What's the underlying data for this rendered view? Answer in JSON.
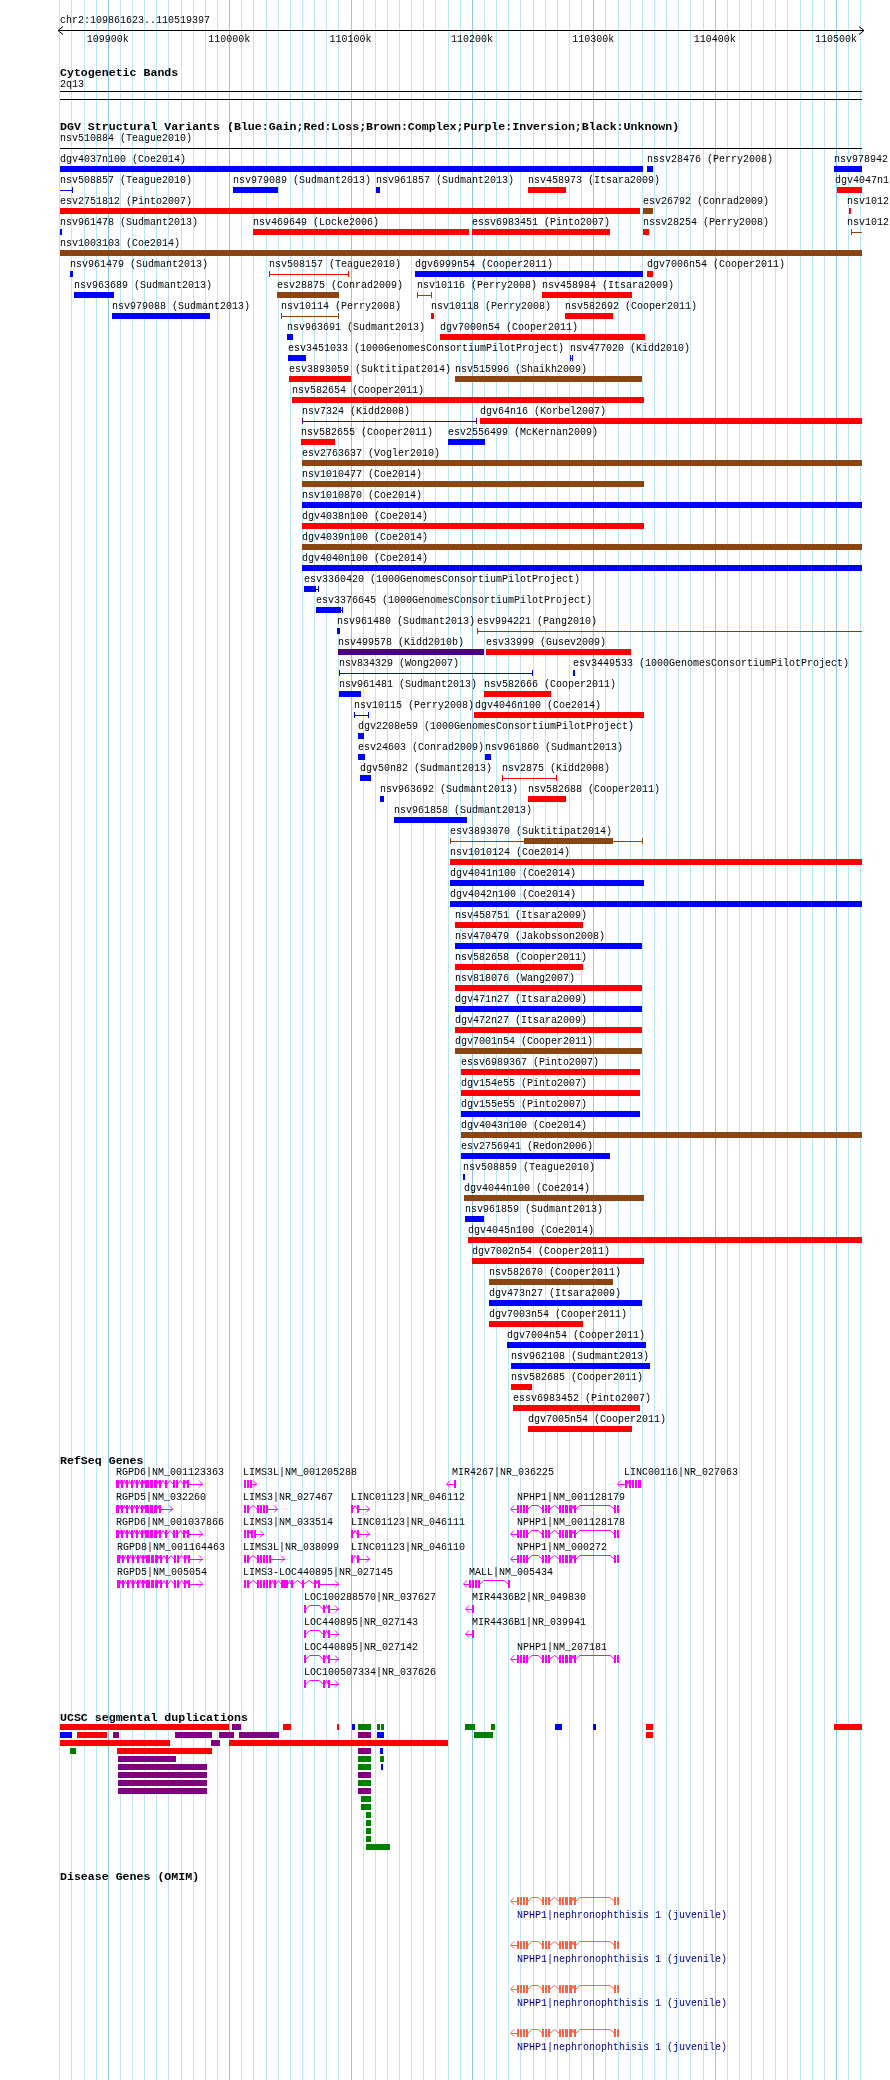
{
  "ruler": {
    "region": "chr2:109861623..110519397",
    "ticks": [
      "109900k",
      "110000k",
      "110100k",
      "110200k",
      "110300k",
      "110400k",
      "110500k"
    ]
  },
  "cytogenetic_bands": {
    "title": "Cytogenetic Bands",
    "band": "2q13"
  },
  "dgv": {
    "title": "DGV Structural Variants (Blue:Gain;Red:Loss;Brown:Complex;Purple:Inversion;Black:Unknown)",
    "rows": [
      {
        "items": [
          {
            "label": "nsv510884 (Teague2010)",
            "color": "#000000",
            "kind": "span"
          }
        ]
      },
      {
        "items": [
          {
            "label": "dgv4037n100 (Coe2014)",
            "color": "#0000ff",
            "kind": "bar"
          },
          {
            "label": "nssv28476 (Perry2008)",
            "color": "#0000ff",
            "kind": "bar"
          },
          {
            "label": "nsv978942",
            "color": "#0000ff",
            "kind": "bar"
          }
        ]
      },
      {
        "items": [
          {
            "label": "nsv508857 (Teague2010)",
            "color": "#0000ff",
            "kind": "span"
          },
          {
            "label": "nsv979089 (Sudmant2013)",
            "color": "#0000ff",
            "kind": "bar"
          },
          {
            "label": "nsv961857 (Sudmant2013)",
            "color": "#0000ff",
            "kind": "bar"
          },
          {
            "label": "nsv458973 (Itsara2009)",
            "color": "#ff0000",
            "kind": "bar"
          },
          {
            "label": "dgv4047n1",
            "color": "#ff0000",
            "kind": "bar"
          }
        ]
      },
      {
        "items": [
          {
            "label": "esv2751812 (Pinto2007)",
            "color": "#ff0000",
            "kind": "bar"
          },
          {
            "label": "esv26792 (Conrad2009)",
            "color": "#8b4513",
            "kind": "bar"
          },
          {
            "label": "nsv1012",
            "color": "#ff0000",
            "kind": "bar"
          }
        ]
      },
      {
        "items": [
          {
            "label": "nsv961478 (Sudmant2013)",
            "color": "#0000ff",
            "kind": "bar"
          },
          {
            "label": "nsv469649 (Locke2006)",
            "color": "#ff0000",
            "kind": "bar"
          },
          {
            "label": "essv6983451 (Pinto2007)",
            "color": "#ff0000",
            "kind": "bar"
          },
          {
            "label": "nssv28254 (Perry2008)",
            "color": "#ff0000",
            "kind": "span_bar"
          },
          {
            "label": "nsv1012",
            "color": "#8b4513",
            "kind": "span"
          }
        ]
      },
      {
        "items": [
          {
            "label": "nsv1003103 (Coe2014)",
            "color": "#8b4513",
            "kind": "bar"
          }
        ]
      },
      {
        "items": [
          {
            "label": "nsv961479 (Sudmant2013)",
            "color": "#0000ff",
            "kind": "bar"
          },
          {
            "label": "nsv508157 (Teague2010)",
            "color": "#ff0000",
            "kind": "span"
          },
          {
            "label": "dgv6999n54 (Cooper2011)",
            "color": "#0000ff",
            "kind": "bar"
          },
          {
            "label": "dgv7006n54 (Cooper2011)",
            "color": "#ff0000",
            "kind": "bar"
          }
        ]
      },
      {
        "items": [
          {
            "label": "nsv963689 (Sudmant2013)",
            "color": "#0000ff",
            "kind": "bar"
          },
          {
            "label": "esv28875 (Conrad2009)",
            "color": "#8b4513",
            "kind": "bar"
          },
          {
            "label": "nsv10116 (Perry2008)",
            "color": "#8b4513",
            "kind": "span"
          },
          {
            "label": "nsv458984 (Itsara2009)",
            "color": "#ff0000",
            "kind": "bar"
          }
        ]
      },
      {
        "items": [
          {
            "label": "nsv979088 (Sudmant2013)",
            "color": "#0000ff",
            "kind": "bar"
          },
          {
            "label": "nsv10114 (Perry2008)",
            "color": "#8b4513",
            "kind": "span"
          },
          {
            "label": "nsv10118 (Perry2008)",
            "color": "#ff0000",
            "kind": "bar"
          },
          {
            "label": "nsv582692 (Cooper2011)",
            "color": "#ff0000",
            "kind": "bar"
          }
        ]
      },
      {
        "items": [
          {
            "label": "nsv963691 (Sudmant2013)",
            "color": "#0000ff",
            "kind": "bar"
          },
          {
            "label": "dgv7000n54 (Cooper2011)",
            "color": "#ff0000",
            "kind": "bar"
          }
        ]
      },
      {
        "items": [
          {
            "label": "esv3451033 (1000GenomesConsortiumPilotProject)",
            "color": "#0000ff",
            "kind": "bar"
          },
          {
            "label": "nsv477020 (Kidd2010)",
            "color": "#0000ff",
            "kind": "span"
          }
        ]
      },
      {
        "items": [
          {
            "label": "esv3893059 (Suktitipat2014)",
            "color": "#ff0000",
            "kind": "bar"
          },
          {
            "label": "nsv515996 (Shaikh2009)",
            "color": "#8b4513",
            "kind": "bar"
          }
        ]
      },
      {
        "items": [
          {
            "label": "nsv582654 (Cooper2011)",
            "color": "#ff0000",
            "kind": "bar"
          }
        ]
      },
      {
        "items": [
          {
            "label": "nsv7324 (Kidd2008)",
            "color": "#4b0082",
            "kind": "span"
          },
          {
            "label": "dgv64n16 (Korbel2007)",
            "color": "#ff0000",
            "kind": "bar"
          }
        ]
      },
      {
        "items": [
          {
            "label": "nsv582655 (Cooper2011)",
            "color": "#ff0000",
            "kind": "bar"
          },
          {
            "label": "esv2556499 (McKernan2009)",
            "color": "#0000ff",
            "kind": "bar"
          }
        ]
      },
      {
        "items": [
          {
            "label": "esv2763637 (Vogler2010)",
            "color": "#8b4513",
            "kind": "bar"
          }
        ]
      },
      {
        "items": [
          {
            "label": "nsv1010477 (Coe2014)",
            "color": "#8b4513",
            "kind": "bar"
          }
        ]
      },
      {
        "items": [
          {
            "label": "nsv1010870 (Coe2014)",
            "color": "#0000ff",
            "kind": "bar"
          }
        ]
      },
      {
        "items": [
          {
            "label": "dgv4038n100 (Coe2014)",
            "color": "#ff0000",
            "kind": "bar"
          }
        ]
      },
      {
        "items": [
          {
            "label": "dgv4039n100 (Coe2014)",
            "color": "#8b4513",
            "kind": "bar"
          }
        ]
      },
      {
        "items": [
          {
            "label": "dgv4040n100 (Coe2014)",
            "color": "#0000ff",
            "kind": "bar"
          }
        ]
      },
      {
        "items": [
          {
            "label": "esv3360420 (1000GenomesConsortiumPilotProject)",
            "color": "#0000ff",
            "kind": "span_bar"
          }
        ]
      },
      {
        "items": [
          {
            "label": "esv3376645 (1000GenomesConsortiumPilotProject)",
            "color": "#0000ff",
            "kind": "span_bar"
          }
        ]
      },
      {
        "items": [
          {
            "label": "nsv961480 (Sudmant2013)",
            "color": "#0000ff",
            "kind": "bar"
          },
          {
            "label": "esv994221 (Pang2010)",
            "color": "#ff0000",
            "kind": "span"
          }
        ]
      },
      {
        "items": [
          {
            "label": "nsv499578 (Kidd2010b)",
            "color": "#4b0082",
            "kind": "bar"
          },
          {
            "label": "esv33999 (Gusev2009)",
            "color": "#ff0000",
            "kind": "bar"
          }
        ]
      },
      {
        "items": [
          {
            "label": "nsv834329 (Wong2007)",
            "color": "#0000ff",
            "kind": "span"
          },
          {
            "label": "esv3449533 (1000GenomesConsortiumPilotProject)",
            "color": "#0000ff",
            "kind": "span"
          }
        ]
      },
      {
        "items": [
          {
            "label": "nsv961481 (Sudmant2013)",
            "color": "#0000ff",
            "kind": "bar"
          },
          {
            "label": "nsv582666 (Cooper2011)",
            "color": "#ff0000",
            "kind": "bar"
          }
        ]
      },
      {
        "items": [
          {
            "label": "nsv10115 (Perry2008)",
            "color": "#0000ff",
            "kind": "span"
          },
          {
            "label": "dgv4046n100 (Coe2014)",
            "color": "#ff0000",
            "kind": "bar"
          }
        ]
      },
      {
        "items": [
          {
            "label": "dgv2208e59 (1000GenomesConsortiumPilotProject)",
            "color": "#0000ff",
            "kind": "bar"
          }
        ]
      },
      {
        "items": [
          {
            "label": "esv24603 (Conrad2009)",
            "color": "#0000ff",
            "kind": "bar"
          },
          {
            "label": "nsv961860 (Sudmant2013)",
            "color": "#0000ff",
            "kind": "bar"
          }
        ]
      },
      {
        "items": [
          {
            "label": "dgv50n82 (Sudmant2013)",
            "color": "#0000ff",
            "kind": "bar"
          },
          {
            "label": "nsv2875 (Kidd2008)",
            "color": "#ff0000",
            "kind": "span"
          }
        ]
      },
      {
        "items": [
          {
            "label": "nsv963692 (Sudmant2013)",
            "color": "#0000ff",
            "kind": "bar"
          },
          {
            "label": "nsv582688 (Cooper2011)",
            "color": "#ff0000",
            "kind": "bar"
          }
        ]
      },
      {
        "items": [
          {
            "label": "nsv961858 (Sudmant2013)",
            "color": "#0000ff",
            "kind": "bar"
          }
        ]
      },
      {
        "items": [
          {
            "label": "esv3893070 (Suktitipat2014)",
            "color": "#8b4513",
            "kind": "span_bar"
          }
        ]
      },
      {
        "items": [
          {
            "label": "nsv1010124 (Coe2014)",
            "color": "#ff0000",
            "kind": "bar"
          }
        ]
      },
      {
        "items": [
          {
            "label": "dgv4041n100 (Coe2014)",
            "color": "#0000ff",
            "kind": "bar"
          }
        ]
      },
      {
        "items": [
          {
            "label": "dgv4042n100 (Coe2014)",
            "color": "#0000ff",
            "kind": "bar"
          }
        ]
      },
      {
        "items": [
          {
            "label": "nsv458751 (Itsara2009)",
            "color": "#ff0000",
            "kind": "bar"
          }
        ]
      },
      {
        "items": [
          {
            "label": "nsv470479 (Jakobsson2008)",
            "color": "#0000ff",
            "kind": "bar"
          }
        ]
      },
      {
        "items": [
          {
            "label": "nsv582658 (Cooper2011)",
            "color": "#ff0000",
            "kind": "bar"
          }
        ]
      },
      {
        "items": [
          {
            "label": "nsv818076 (Wang2007)",
            "color": "#ff0000",
            "kind": "bar"
          }
        ]
      },
      {
        "items": [
          {
            "label": "dgv471n27 (Itsara2009)",
            "color": "#0000ff",
            "kind": "bar"
          }
        ]
      },
      {
        "items": [
          {
            "label": "dgv472n27 (Itsara2009)",
            "color": "#ff0000",
            "kind": "bar"
          }
        ]
      },
      {
        "items": [
          {
            "label": "dgv7001n54 (Cooper2011)",
            "color": "#8b4513",
            "kind": "bar"
          }
        ]
      },
      {
        "items": [
          {
            "label": "essv6989367 (Pinto2007)",
            "color": "#ff0000",
            "kind": "bar"
          }
        ]
      },
      {
        "items": [
          {
            "label": "dgv154e55 (Pinto2007)",
            "color": "#ff0000",
            "kind": "bar"
          }
        ]
      },
      {
        "items": [
          {
            "label": "dgv155e55 (Pinto2007)",
            "color": "#0000ff",
            "kind": "bar"
          }
        ]
      },
      {
        "items": [
          {
            "label": "dgv4043n100 (Coe2014)",
            "color": "#8b4513",
            "kind": "bar"
          }
        ]
      },
      {
        "items": [
          {
            "label": "esv2756941 (Redon2006)",
            "color": "#0000ff",
            "kind": "bar"
          }
        ]
      },
      {
        "items": [
          {
            "label": "nsv508859 (Teague2010)",
            "color": "#0000ff",
            "kind": "bar"
          }
        ]
      },
      {
        "items": [
          {
            "label": "dgv4044n100 (Coe2014)",
            "color": "#8b4513",
            "kind": "bar"
          }
        ]
      },
      {
        "items": [
          {
            "label": "nsv961859 (Sudmant2013)",
            "color": "#0000ff",
            "kind": "bar"
          }
        ]
      },
      {
        "items": [
          {
            "label": "dgv4045n100 (Coe2014)",
            "color": "#ff0000",
            "kind": "bar"
          }
        ]
      },
      {
        "items": [
          {
            "label": "dgv7002n54 (Cooper2011)",
            "color": "#ff0000",
            "kind": "bar"
          }
        ]
      },
      {
        "items": [
          {
            "label": "nsv582670 (Cooper2011)",
            "color": "#8b4513",
            "kind": "bar"
          }
        ]
      },
      {
        "items": [
          {
            "label": "dgv473n27 (Itsara2009)",
            "color": "#0000ff",
            "kind": "bar"
          }
        ]
      },
      {
        "items": [
          {
            "label": "dgv7003n54 (Cooper2011)",
            "color": "#ff0000",
            "kind": "bar"
          }
        ]
      },
      {
        "items": [
          {
            "label": "dgv7004n54 (Cooper2011)",
            "color": "#0000ff",
            "kind": "bar"
          }
        ]
      },
      {
        "items": [
          {
            "label": "nsv962108 (Sudmant2013)",
            "color": "#0000ff",
            "kind": "bar"
          }
        ]
      },
      {
        "items": [
          {
            "label": "nsv582685 (Cooper2011)",
            "color": "#ff0000",
            "kind": "bar"
          }
        ]
      },
      {
        "items": [
          {
            "label": "essv6983452 (Pinto2007)",
            "color": "#ff0000",
            "kind": "bar"
          }
        ]
      },
      {
        "items": [
          {
            "label": "dgv7005n54 (Cooper2011)",
            "color": "#ff0000",
            "kind": "bar"
          }
        ]
      }
    ]
  },
  "refseq": {
    "title": "RefSeq Genes",
    "rows": [
      {
        "items": [
          {
            "label": "RGPD6|NM_001123363",
            "reverse_strand": false
          },
          {
            "label": "LIMS3L|NM_001205288",
            "reverse_strand": false
          },
          {
            "label": "MIR4267|NR_036225",
            "reverse_strand": true
          },
          {
            "label": "LINC00116|NR_027063",
            "reverse_strand": true
          }
        ]
      },
      {
        "items": [
          {
            "label": "RGPD5|NM_032260",
            "reverse_strand": false
          },
          {
            "label": "LIMS3|NR_027467",
            "reverse_strand": false
          },
          {
            "label": "LINC01123|NR_046112",
            "reverse_strand": false
          },
          {
            "label": "NPHP1|NM_001128179",
            "reverse_strand": true
          }
        ]
      },
      {
        "items": [
          {
            "label": "RGPD6|NM_001037866",
            "reverse_strand": false
          },
          {
            "label": "LIMS3|NM_033514",
            "reverse_strand": false
          },
          {
            "label": "LINC01123|NR_046111",
            "reverse_strand": false
          },
          {
            "label": "NPHP1|NM_001128178",
            "reverse_strand": true
          }
        ]
      },
      {
        "items": [
          {
            "label": "RGPD8|NM_001164463",
            "reverse_strand": false
          },
          {
            "label": "LIMS3L|NR_038099",
            "reverse_strand": false
          },
          {
            "label": "LINC01123|NR_046110",
            "reverse_strand": false
          },
          {
            "label": "NPHP1|NM_000272",
            "reverse_strand": true
          }
        ]
      },
      {
        "items": [
          {
            "label": "RGPD5|NM_005054",
            "reverse_strand": false
          },
          {
            "label": "LIMS3-LOC440895|NR_027145",
            "reverse_strand": false
          },
          {
            "label": "MALL|NM_005434",
            "reverse_strand": true
          }
        ]
      },
      {
        "items": [
          {
            "label": "LOC100288570|NR_037627",
            "reverse_strand": false
          },
          {
            "label": "MIR4436B2|NR_049830",
            "reverse_strand": true
          }
        ]
      },
      {
        "items": [
          {
            "label": "LOC440895|NR_027143",
            "reverse_strand": false
          },
          {
            "label": "MIR4436B1|NR_039941",
            "reverse_strand": true
          }
        ]
      },
      {
        "items": [
          {
            "label": "LOC440895|NR_027142",
            "reverse_strand": false
          },
          {
            "label": "NPHP1|NM_207181",
            "reverse_strand": true
          }
        ]
      },
      {
        "items": [
          {
            "label": "LOC100507334|NR_037626",
            "reverse_strand": false
          }
        ]
      }
    ]
  },
  "segmental_duplications": {
    "title": "UCSC segmental duplications",
    "rows": [
      {
        "items": [
          {
            "color": "#ff0000"
          },
          {
            "color": "#800080"
          },
          {
            "color": "#ff0000"
          },
          {
            "color": "#ff0000"
          },
          {
            "color": "#0000ff"
          },
          {
            "color": "#008000"
          },
          {
            "color": "#008000"
          },
          {
            "color": "#008000"
          },
          {
            "color": "#008000"
          },
          {
            "color": "#008000"
          },
          {
            "color": "#0000ff"
          },
          {
            "color": "#0000ff"
          },
          {
            "color": "#ff0000"
          },
          {
            "color": "#ff0000"
          }
        ]
      },
      {
        "items": [
          {
            "color": "#0000ff"
          },
          {
            "color": "#ff0000"
          },
          {
            "color": "#800080"
          },
          {
            "color": "#800080"
          },
          {
            "color": "#800080"
          },
          {
            "color": "#800080"
          },
          {
            "color": "#800080"
          },
          {
            "color": "#0000ff"
          },
          {
            "color": "#008000"
          },
          {
            "color": "#ff0000"
          }
        ]
      },
      {
        "items": [
          {
            "color": "#ff0000"
          },
          {
            "color": "#800080"
          },
          {
            "color": "#ff0000"
          }
        ]
      },
      {
        "items": [
          {
            "color": "#008000"
          },
          {
            "color": "#ff0000"
          },
          {
            "color": "#800080"
          },
          {
            "color": "#0000ff"
          }
        ]
      },
      {
        "items": [
          {
            "color": "#800080"
          },
          {
            "color": "#008000"
          },
          {
            "color": "#008000"
          }
        ]
      },
      {
        "items": [
          {
            "color": "#800080"
          },
          {
            "color": "#008000"
          },
          {
            "color": "#0000ff"
          }
        ]
      },
      {
        "items": [
          {
            "color": "#800080"
          },
          {
            "color": "#800080"
          }
        ]
      },
      {
        "items": [
          {
            "color": "#800080"
          },
          {
            "color": "#008000"
          }
        ]
      },
      {
        "items": [
          {
            "color": "#800080"
          },
          {
            "color": "#800080"
          }
        ]
      },
      {
        "items": [
          {
            "color": "#008000"
          }
        ]
      },
      {
        "items": [
          {
            "color": "#008000"
          }
        ]
      },
      {
        "items": [
          {
            "color": "#008000"
          }
        ]
      },
      {
        "items": [
          {
            "color": "#008000"
          }
        ]
      },
      {
        "items": [
          {
            "color": "#008000"
          }
        ]
      },
      {
        "items": [
          {
            "color": "#008000"
          }
        ]
      },
      {
        "items": [
          {
            "color": "#008000"
          }
        ]
      }
    ]
  },
  "omim": {
    "title": "Disease Genes (OMIM)",
    "genes": [
      {
        "label": "NPHP1|nephronophthisis 1 (juvenile)",
        "reverse_strand": true
      },
      {
        "label": "NPHP1|nephronophthisis 1 (juvenile)",
        "reverse_strand": true
      },
      {
        "label": "NPHP1|nephronophthisis 1 (juvenile)",
        "reverse_strand": true
      },
      {
        "label": "NPHP1|nephronophthisis 1 (juvenile)",
        "reverse_strand": true
      }
    ]
  }
}
